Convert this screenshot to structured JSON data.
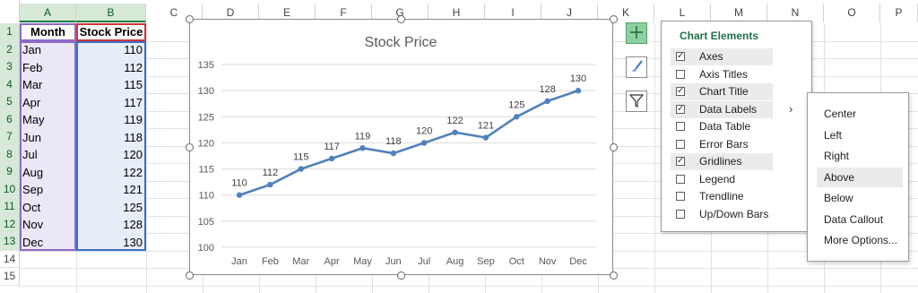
{
  "sheet": {
    "columns": [
      "A",
      "B",
      "C",
      "D",
      "E",
      "F",
      "G",
      "H",
      "I",
      "J",
      "K",
      "L",
      "M",
      "N",
      "O",
      "P"
    ],
    "rows": [
      "1",
      "2",
      "3",
      "4",
      "5",
      "6",
      "7",
      "8",
      "9",
      "10",
      "11",
      "12",
      "13",
      "14",
      "15"
    ],
    "headers": {
      "month": "Month",
      "price": "Stock Price"
    },
    "data": [
      {
        "month": "Jan",
        "price": "110"
      },
      {
        "month": "Feb",
        "price": "112"
      },
      {
        "month": "Mar",
        "price": "115"
      },
      {
        "month": "Apr",
        "price": "117"
      },
      {
        "month": "May",
        "price": "119"
      },
      {
        "month": "Jun",
        "price": "118"
      },
      {
        "month": "Jul",
        "price": "120"
      },
      {
        "month": "Aug",
        "price": "122"
      },
      {
        "month": "Sep",
        "price": "121"
      },
      {
        "month": "Oct",
        "price": "125"
      },
      {
        "month": "Nov",
        "price": "128"
      },
      {
        "month": "Dec",
        "price": "130"
      }
    ]
  },
  "chart_data": {
    "type": "line",
    "title": "Stock Price",
    "xlabel": "",
    "ylabel": "",
    "categories": [
      "Jan",
      "Feb",
      "Mar",
      "Apr",
      "May",
      "Jun",
      "Jul",
      "Aug",
      "Sep",
      "Oct",
      "Nov",
      "Dec"
    ],
    "series": [
      {
        "values": [
          110,
          112,
          115,
          117,
          119,
          118,
          120,
          122,
          121,
          125,
          128,
          130
        ],
        "color": "#4f81bd"
      }
    ],
    "ylim": [
      100,
      135
    ],
    "yticks": [
      100,
      105,
      110,
      115,
      120,
      125,
      130,
      135
    ],
    "grid": true,
    "data_labels": "above",
    "legend": "none"
  },
  "chart_buttons": {
    "add": "plus-icon",
    "style": "paintbrush-icon",
    "filter": "funnel-icon"
  },
  "chart_elements": {
    "title": "Chart Elements",
    "items": [
      {
        "label": "Axes",
        "checked": true,
        "highlight": true
      },
      {
        "label": "Axis Titles",
        "checked": false,
        "highlight": false
      },
      {
        "label": "Chart Title",
        "checked": true,
        "highlight": true
      },
      {
        "label": "Data Labels",
        "checked": true,
        "highlight": true
      },
      {
        "label": "Data Table",
        "checked": false,
        "highlight": false
      },
      {
        "label": "Error Bars",
        "checked": false,
        "highlight": false
      },
      {
        "label": "Gridlines",
        "checked": true,
        "highlight": true
      },
      {
        "label": "Legend",
        "checked": false,
        "highlight": false
      },
      {
        "label": "Trendline",
        "checked": false,
        "highlight": false
      },
      {
        "label": "Up/Down Bars",
        "checked": false,
        "highlight": false
      }
    ],
    "submenu_arrow": "›"
  },
  "data_labels_submenu": {
    "items": [
      "Center",
      "Left",
      "Right",
      "Above",
      "Below",
      "Data Callout",
      "More Options..."
    ],
    "highlighted": "Above"
  },
  "colors": {
    "accent": "#217346",
    "series": "#4f81bd",
    "range_a": "#8e6ac8",
    "range_b": "#3a6fc9",
    "header_range": "#d13438"
  }
}
